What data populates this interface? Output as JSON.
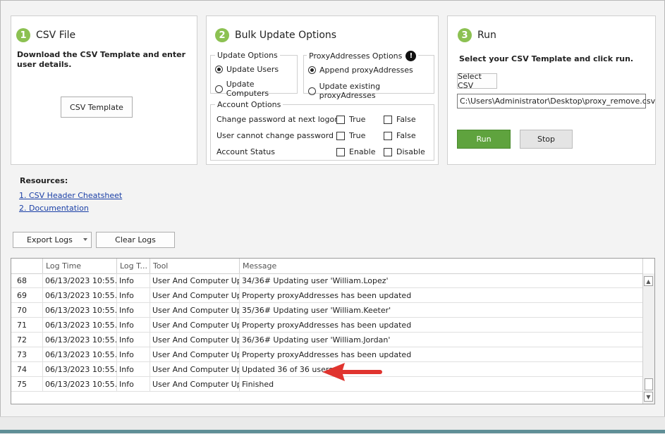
{
  "step1": {
    "num": "1",
    "title": "CSV File",
    "desc": "Download the CSV Template and enter user details.",
    "template_btn": "CSV Template"
  },
  "step2": {
    "num": "2",
    "title": "Bulk Update Options",
    "update_options": {
      "title": "Update Options",
      "opt1": "Update Users",
      "opt2": "Update Computers",
      "selected": "Update Users"
    },
    "proxy_options": {
      "title": "ProxyAddresses Options",
      "opt1": "Append proxyAddresses",
      "opt2": "Update existing proxyAdresses",
      "selected": "Append proxyAddresses"
    },
    "account_options": {
      "title": "Account Options",
      "rows": [
        {
          "label": "Change password at next logon",
          "a": "True",
          "b": "False"
        },
        {
          "label": "User cannot change password",
          "a": "True",
          "b": "False"
        },
        {
          "label": "Account Status",
          "a": "Enable",
          "b": "Disable"
        }
      ]
    }
  },
  "step3": {
    "num": "3",
    "title": "Run",
    "desc": "Select your CSV Template and click run.",
    "select_btn": "Select CSV",
    "path": "C:\\Users\\Administrator\\Desktop\\proxy_remove.csv",
    "run_btn": "Run",
    "stop_btn": "Stop"
  },
  "resources": {
    "title": "Resources:",
    "link1": "1. CSV Header Cheatsheet",
    "link2": "2. Documentation"
  },
  "toolbar": {
    "export": "Export Logs",
    "clear": "Clear Logs"
  },
  "log": {
    "columns": [
      "",
      "Log Time",
      "Log T...",
      "Tool",
      "Message"
    ],
    "rows": [
      {
        "n": "68",
        "time": "06/13/2023 10:55...",
        "type": "Info",
        "tool": "User And Computer Up...",
        "msg": "34/36# Updating user 'William.Lopez'"
      },
      {
        "n": "69",
        "time": "06/13/2023 10:55...",
        "type": "Info",
        "tool": "User And Computer Up...",
        "msg": " Property proxyAddresses has been updated"
      },
      {
        "n": "70",
        "time": "06/13/2023 10:55...",
        "type": "Info",
        "tool": "User And Computer Up...",
        "msg": "35/36# Updating user 'William.Keeter'"
      },
      {
        "n": "71",
        "time": "06/13/2023 10:55...",
        "type": "Info",
        "tool": "User And Computer Up...",
        "msg": " Property proxyAddresses has been updated"
      },
      {
        "n": "72",
        "time": "06/13/2023 10:55...",
        "type": "Info",
        "tool": "User And Computer Up...",
        "msg": "36/36# Updating user 'William.Jordan'"
      },
      {
        "n": "73",
        "time": "06/13/2023 10:55...",
        "type": "Info",
        "tool": "User And Computer Up...",
        "msg": " Property proxyAddresses has been updated"
      },
      {
        "n": "74",
        "time": "06/13/2023 10:55...",
        "type": "Info",
        "tool": "User And Computer Up...",
        "msg": "Updated 36 of 36 users"
      },
      {
        "n": "75",
        "time": "06/13/2023 10:55...",
        "type": "Info",
        "tool": "User And Computer Up...",
        "msg": "Finished"
      }
    ]
  },
  "colors": {
    "accent_green": "#8cc152",
    "run_button": "#5fa33e",
    "arrow_red": "#e0342f",
    "link": "#1a3fa6"
  },
  "icons": {
    "warning": "exclamation-circle-icon",
    "dropdown": "chevron-down-icon",
    "scroll_up": "arrow-up-icon",
    "scroll_down": "arrow-down-icon",
    "annotation": "red-arrow"
  }
}
